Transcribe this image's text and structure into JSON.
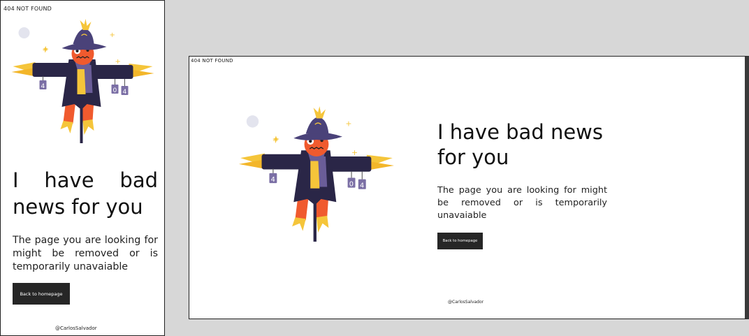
{
  "pages": {
    "mobile": {
      "topbar": "404 NOT FOUND",
      "headline": "I have bad news for you",
      "description": "The page you are looking for might be removed or is temporarily unavaiable",
      "button": "Back to homepage",
      "credit": "@CarlosSalvador"
    },
    "desktop": {
      "topbar": "404 NOT FOUND",
      "headline": "I have bad news for you",
      "description": "The page you are looking for might be removed or is temporarily unavaiable",
      "button": "Back to homepage",
      "credit": "@CarlosSalvador"
    }
  },
  "illustration": {
    "icon": "scarecrow-illustration",
    "tags": [
      "4",
      "0",
      "4"
    ]
  },
  "colors": {
    "background": "#d7d7d7",
    "frame": "#ffffff",
    "button": "#262626",
    "text": "#1c1c1c",
    "coat": "#2a2647",
    "hat": "#4a4279",
    "head": "#f05a2e",
    "straw": "#f5c53a",
    "moon": "#e3e4ee"
  }
}
